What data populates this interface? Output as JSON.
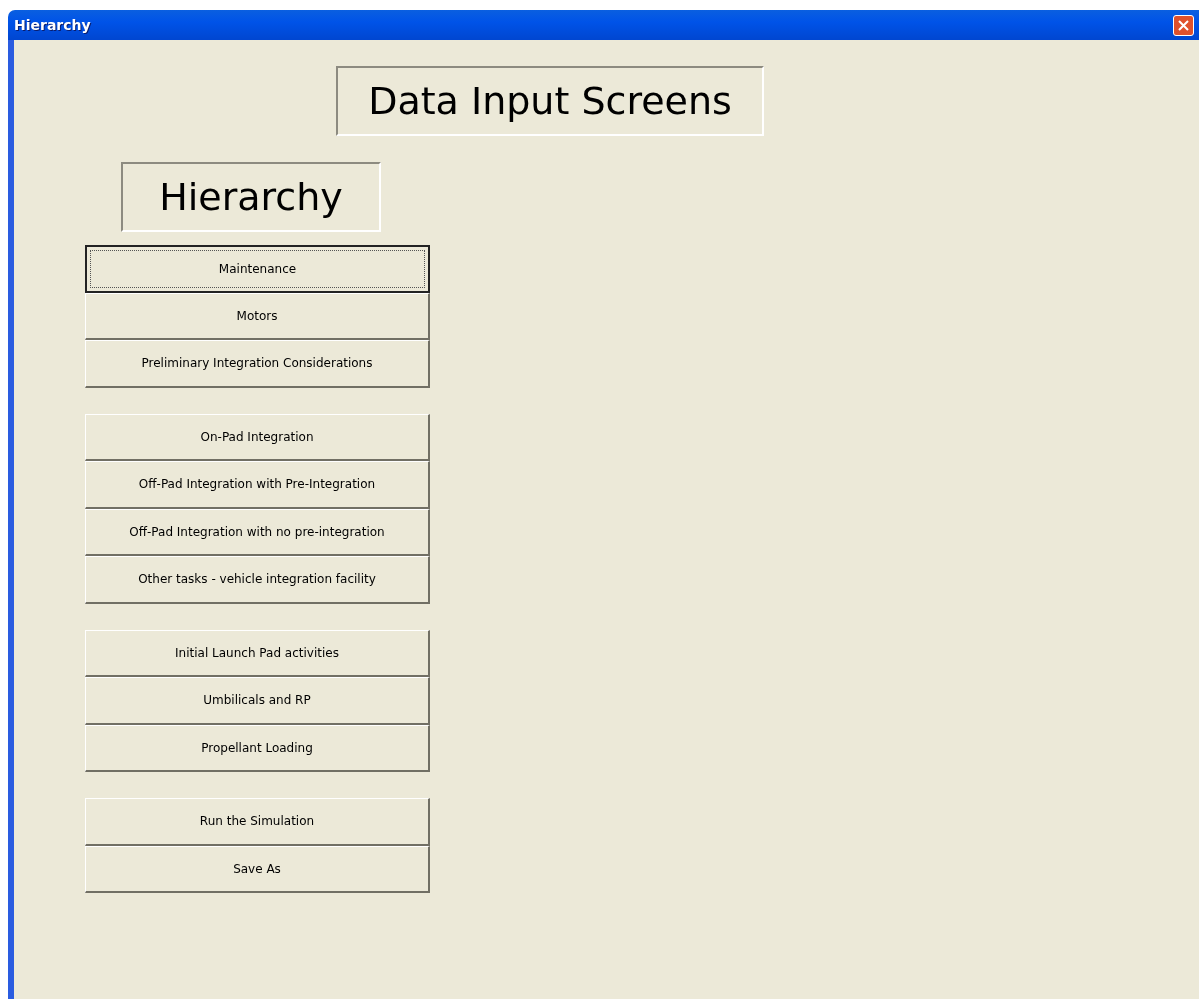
{
  "window": {
    "title": "Hierarchy"
  },
  "heading": "Data Input Screens",
  "subheading": "Hierarchy",
  "button_groups": [
    {
      "buttons": [
        {
          "label": "Maintenance",
          "focused": true
        },
        {
          "label": "Motors",
          "focused": false
        },
        {
          "label": "Preliminary Integration Considerations",
          "focused": false
        }
      ]
    },
    {
      "buttons": [
        {
          "label": "On-Pad Integration",
          "focused": false
        },
        {
          "label": "Off-Pad Integration with Pre-Integration",
          "focused": false
        },
        {
          "label": "Off-Pad Integration with no pre-integration",
          "focused": false
        },
        {
          "label": "Other tasks - vehicle integration facility",
          "focused": false
        }
      ]
    },
    {
      "buttons": [
        {
          "label": "Initial Launch Pad activities",
          "focused": false
        },
        {
          "label": "Umbilicals and RP",
          "focused": false
        },
        {
          "label": "Propellant Loading",
          "focused": false
        }
      ]
    },
    {
      "buttons": [
        {
          "label": "Run the Simulation",
          "focused": false
        },
        {
          "label": "Save As",
          "focused": false
        }
      ]
    }
  ]
}
